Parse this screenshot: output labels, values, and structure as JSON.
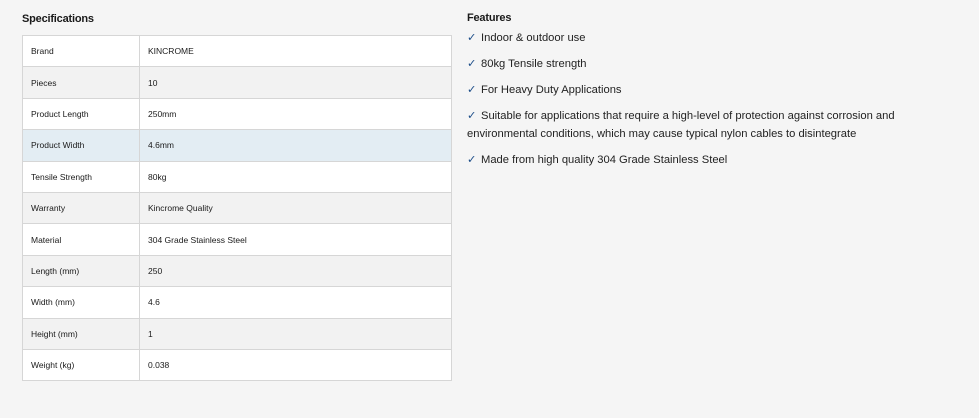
{
  "specifications": {
    "title": "Specifications",
    "rows": [
      {
        "label": "Brand",
        "value": "KINCROME"
      },
      {
        "label": "Pieces",
        "value": "10"
      },
      {
        "label": "Product Length",
        "value": "250mm"
      },
      {
        "label": "Product Width",
        "value": "4.6mm"
      },
      {
        "label": "Tensile Strength",
        "value": "80kg"
      },
      {
        "label": "Warranty",
        "value": "Kincrome Quality"
      },
      {
        "label": "Material",
        "value": "304 Grade Stainless Steel"
      },
      {
        "label": "Length (mm)",
        "value": "250"
      },
      {
        "label": "Width (mm)",
        "value": "4.6"
      },
      {
        "label": "Height (mm)",
        "value": "1"
      },
      {
        "label": "Weight (kg)",
        "value": "0.038"
      }
    ]
  },
  "features": {
    "title": "Features",
    "check_icon": "checkmark-icon",
    "check_color": "#1d4e89",
    "items": [
      "Indoor & outdoor use",
      "80kg Tensile strength",
      "For Heavy Duty Applications",
      "Suitable for applications that require a high-level of protection against corrosion and environmental conditions, which may cause typical nylon cables to disintegrate",
      "Made from high quality 304 Grade Stainless Steel"
    ]
  }
}
